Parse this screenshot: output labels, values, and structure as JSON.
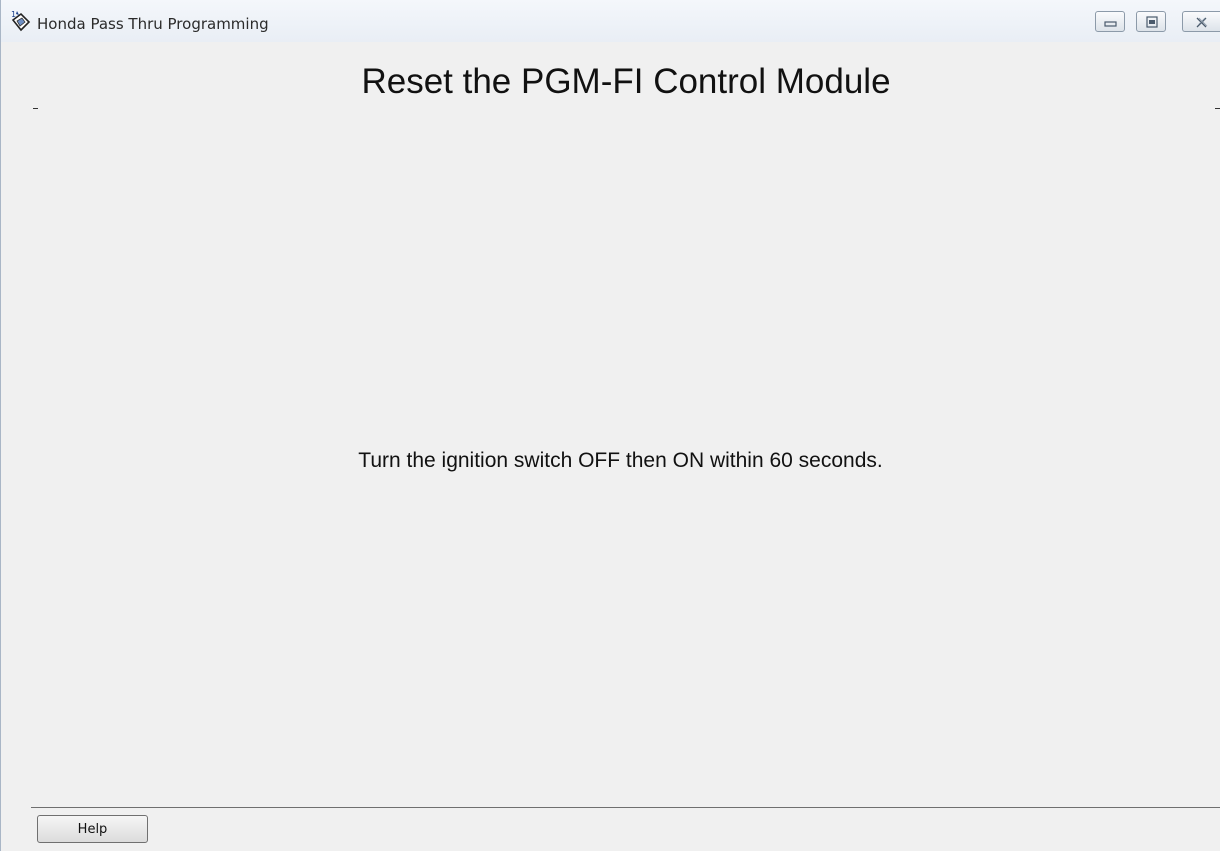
{
  "window": {
    "title": "Honda Pass Thru Programming",
    "icon": "honda-app-icon",
    "controls": {
      "minimize_icon": "minimize-icon",
      "maximize_icon": "maximize-icon",
      "close_icon": "close-icon"
    }
  },
  "main": {
    "title": "Reset the PGM-FI Control Module",
    "instruction": "Turn the ignition switch OFF then ON within 60 seconds."
  },
  "footer": {
    "help_label": "Help"
  },
  "colors": {
    "background": "#f0f0f0",
    "titlebar": "#edf1f6",
    "text": "#111111"
  }
}
